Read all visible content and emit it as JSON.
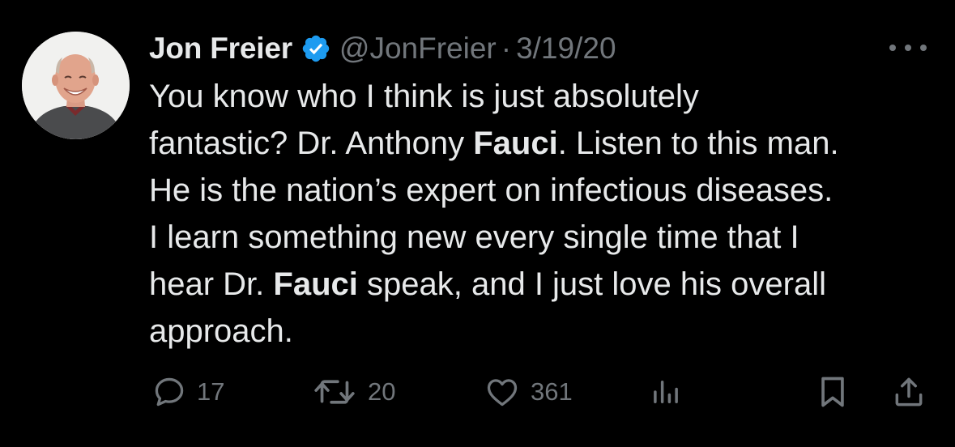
{
  "tweet": {
    "author": {
      "display_name": "Jon Freier",
      "handle": "@JonFreier",
      "verified": true
    },
    "separator": "·",
    "date": "3/19/20",
    "text_lines": [
      [
        "You know who I think is just absolutely"
      ],
      [
        "fantastic? Dr. Anthony ",
        "Fauci",
        ". Listen to this man."
      ],
      [
        "He is the nation’s expert on infectious diseases."
      ],
      [
        "I learn something new every single time that I"
      ],
      [
        "hear Dr. ",
        "Fauci",
        " speak, and I just love his overall"
      ],
      [
        "approach."
      ]
    ],
    "line_1": "You know who I think is just absolutely",
    "line_2_pre": "fantastic? Dr. Anthony ",
    "line_2_bold": "Fauci",
    "line_2_post": ". Listen to this man.",
    "line_3": "He is the nation’s expert on infectious diseases.",
    "line_4": "I learn something new every single time that I",
    "line_5_pre": "hear Dr. ",
    "line_5_bold": "Fauci",
    "line_5_post": " speak, and I just love his overall",
    "line_6": "approach.",
    "actions": {
      "replies": "17",
      "retweets": "20",
      "likes": "361"
    },
    "icons": {
      "more": "more-horizontal-icon",
      "verified": "verified-badge-icon",
      "reply": "reply-bubble-icon",
      "retweet": "retweet-arrows-icon",
      "like": "heart-icon",
      "views": "analytics-bars-icon",
      "bookmark": "bookmark-icon",
      "share": "share-upload-icon"
    }
  },
  "colors": {
    "background": "#000000",
    "primary_text": "#e7e9ea",
    "secondary_text": "#71767b",
    "verified_blue": "#1d9bf0"
  }
}
